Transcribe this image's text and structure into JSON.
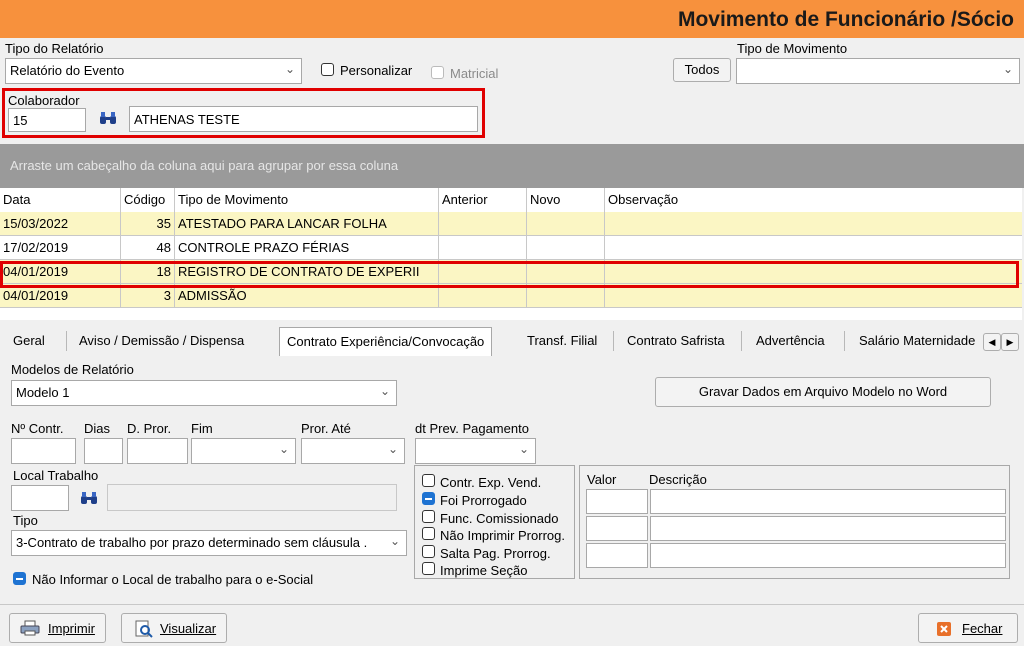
{
  "window": {
    "title": "Movimento de Funcionário /Sócio"
  },
  "filters": {
    "report_type_label": "Tipo do Relatório",
    "report_type_value": "Relatório do Evento",
    "personalizar_label": "Personalizar",
    "matricial_label": "Matricial",
    "movement_type_label": "Tipo de Movimento",
    "todos_label": "Todos",
    "movement_type_value": ""
  },
  "colaborador": {
    "label": "Colaborador",
    "code": "15",
    "name": "ATHENAS TESTE"
  },
  "grid": {
    "group_hint": "Arraste um cabeçalho da coluna aqui para agrupar por essa coluna",
    "columns": [
      "Data",
      "Código",
      "Tipo de Movimento",
      "Anterior",
      "Novo",
      "Observação"
    ],
    "rows": [
      {
        "data": "15/03/2022",
        "codigo": "35",
        "tipo": "ATESTADO PARA LANCAR FOLHA",
        "anterior": "",
        "novo": "",
        "obs": ""
      },
      {
        "data": "17/02/2019",
        "codigo": "48",
        "tipo": "CONTROLE PRAZO FÉRIAS",
        "anterior": "",
        "novo": "",
        "obs": ""
      },
      {
        "data": "04/01/2019",
        "codigo": "18",
        "tipo": "REGISTRO DE CONTRATO DE EXPERII",
        "anterior": "",
        "novo": "",
        "obs": ""
      },
      {
        "data": "04/01/2019",
        "codigo": "3",
        "tipo": "ADMISSÃO",
        "anterior": "",
        "novo": "",
        "obs": ""
      }
    ]
  },
  "tabs": [
    "Geral",
    "Aviso / Demissão / Dispensa",
    "Contrato Experiência/Convocação",
    "Transf. Filial",
    "Contrato Safrista",
    "Advertência",
    "Salário Maternidade"
  ],
  "contract": {
    "models_label": "Modelos de Relatório",
    "model_value": "Modelo 1",
    "save_word_label": "Gravar Dados em Arquivo Modelo no Word",
    "n_contr_label": "Nº Contr.",
    "dias_label": "Dias",
    "d_pror_label": "D. Pror.",
    "fim_label": "Fim",
    "pror_ate_label": "Pror. Até",
    "dt_prev_label": "dt Prev. Pagamento",
    "local_trabalho_label": "Local Trabalho",
    "tipo_label": "Tipo",
    "tipo_value": "3-Contrato de trabalho por prazo determinado sem cláusula .",
    "nao_informar_label": "Não Informar o Local de trabalho para o e-Social",
    "checks": [
      {
        "label": "Contr. Exp. Vend.",
        "checked": false
      },
      {
        "label": "Foi Prorrogado",
        "checked": true
      },
      {
        "label": "Func. Comissionado",
        "checked": false
      },
      {
        "label": "Não Imprimir Prorrog.",
        "checked": false
      },
      {
        "label": "Salta Pag. Prorrog.",
        "checked": false
      },
      {
        "label": "Imprime Seção",
        "checked": false
      }
    ],
    "valor_label": "Valor",
    "descricao_label": "Descrição"
  },
  "footer": {
    "print_label": "Imprimir",
    "view_label": "Visualizar",
    "close_label": "Fechar"
  },
  "colors": {
    "title_bar": "#f7913d",
    "highlight": "#e00000",
    "row_yellow": "#fbf6c4",
    "group_bar": "#9a9a9a"
  }
}
